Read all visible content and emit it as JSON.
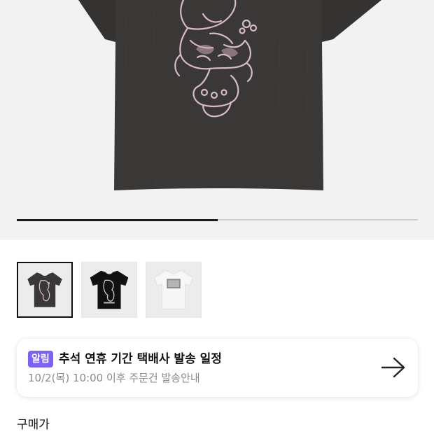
{
  "product": {
    "image_alt": "티셔츠 상품 이미지",
    "gallery_progress": 0.5
  },
  "thumbnails": [
    {
      "label": "charcoal-tee",
      "selected": true
    },
    {
      "label": "black-tee",
      "selected": false
    },
    {
      "label": "white-tee",
      "selected": false
    }
  ],
  "notice": {
    "badge": "알림",
    "title": "추석 연휴 기간 택배사 발송 일정",
    "subtitle": "10/2(목) 10:00 이후 주문건 발송안내",
    "arrow_icon": "arrow-right-icon",
    "badge_color": "#7b61ff"
  },
  "price": {
    "label": "구매가"
  }
}
